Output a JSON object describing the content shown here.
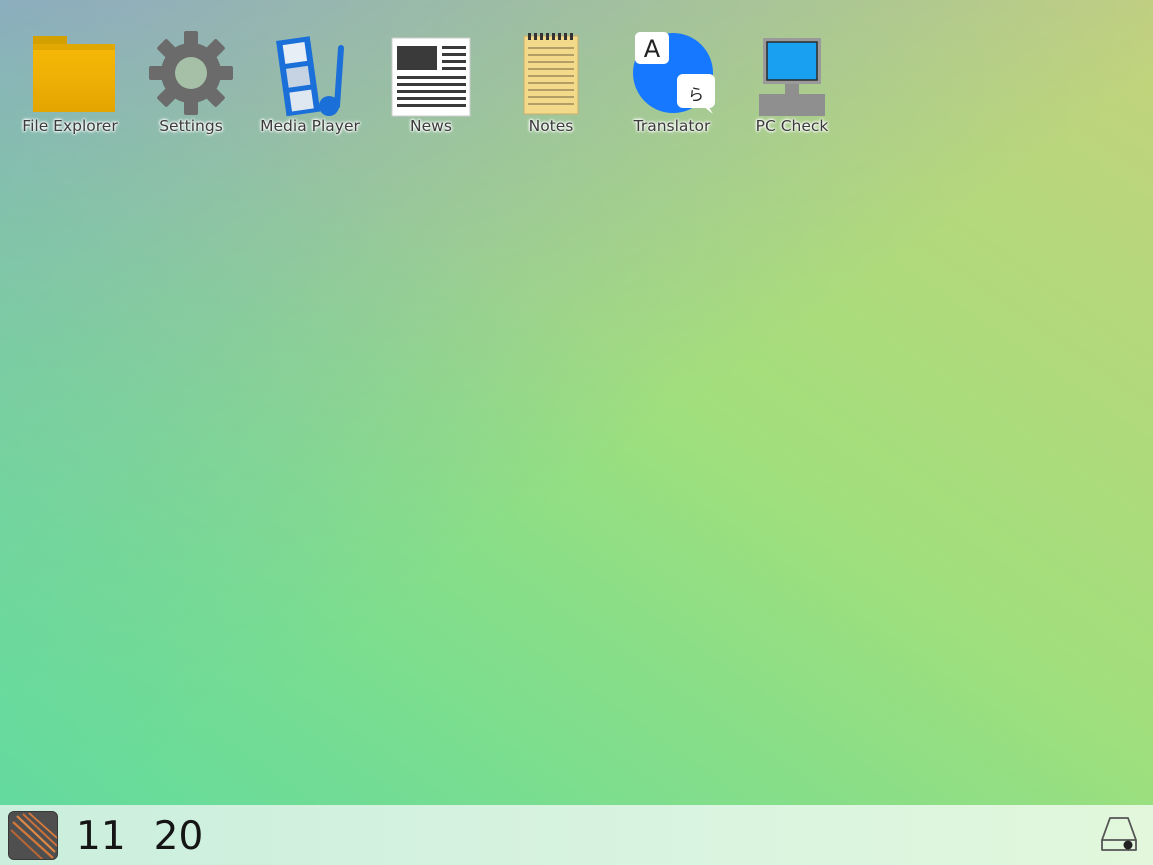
{
  "desktop": {
    "apps": [
      {
        "label": "File Explorer",
        "icon": "folder-icon"
      },
      {
        "label": "Settings",
        "icon": "gear-icon"
      },
      {
        "label": "Media Player",
        "icon": "media-player-icon"
      },
      {
        "label": "News",
        "icon": "newspaper-icon"
      },
      {
        "label": "Notes",
        "icon": "notepad-icon"
      },
      {
        "label": "Translator",
        "icon": "translator-icon"
      },
      {
        "label": "PC Check",
        "icon": "computer-icon"
      }
    ]
  },
  "taskbar": {
    "start_icon": "start-menu-icon",
    "clock": {
      "hours": "11",
      "minutes": "20"
    },
    "tray_icon": "storage-drive-icon"
  },
  "colors": {
    "folder": "#f2b300",
    "gear": "#6b6b6b",
    "media_blue": "#1a6fd8",
    "translator_blue": "#1677ff",
    "monitor_screen": "#1aa0f0",
    "notes_paper": "#f3d98a"
  }
}
